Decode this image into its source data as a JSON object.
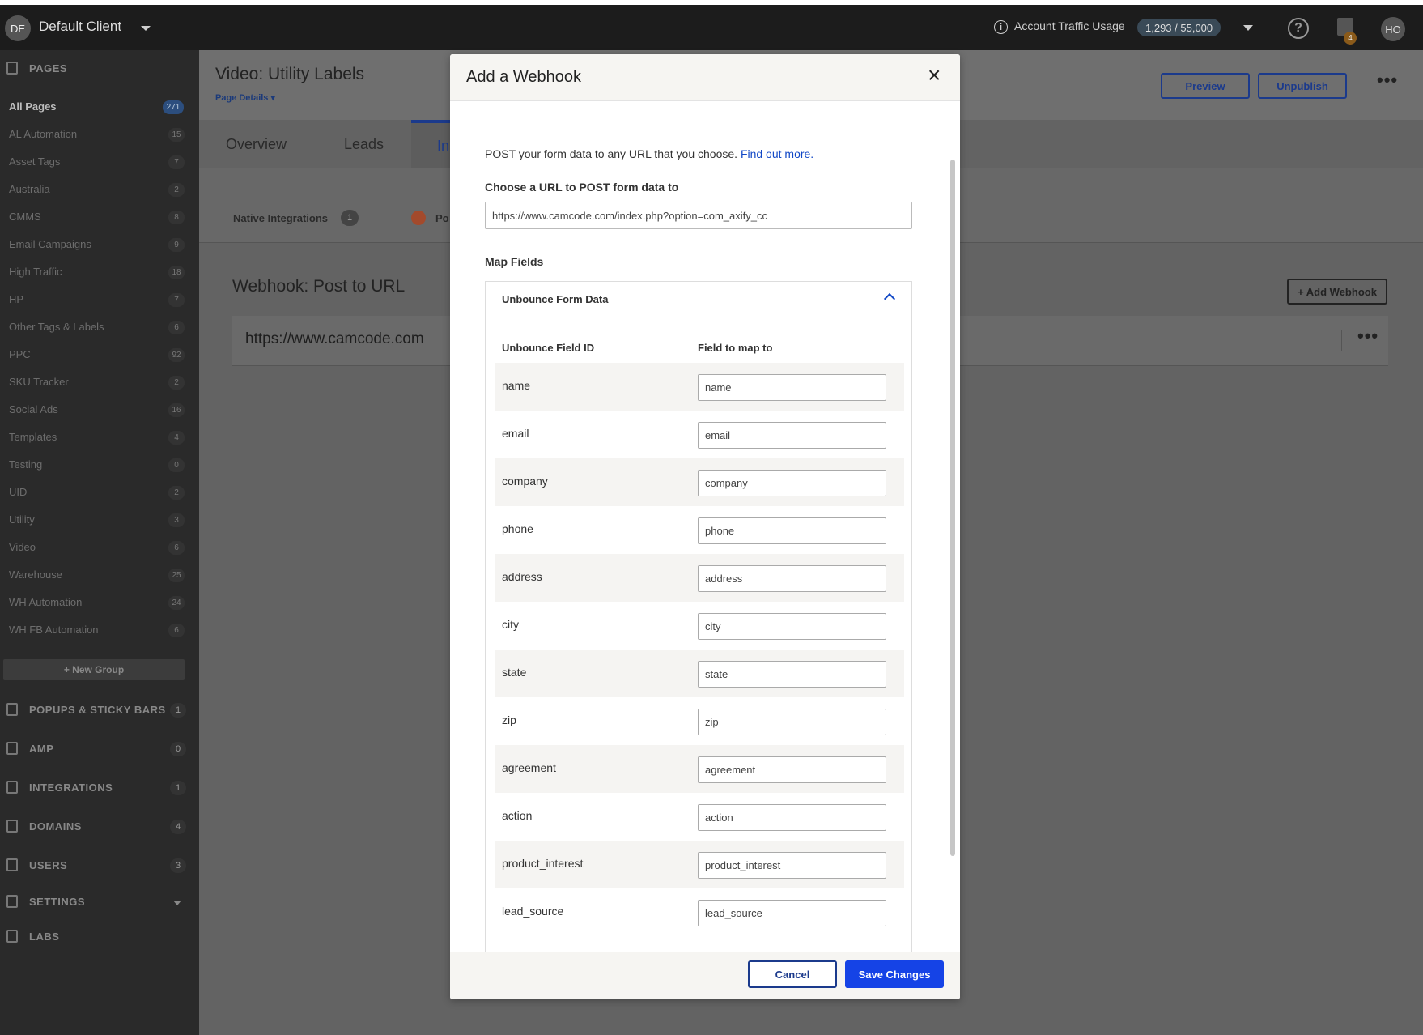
{
  "topbar": {
    "client_initials": "DE",
    "client_name": "Default Client",
    "traffic_label": "Account Traffic Usage",
    "traffic_count": "1,293 / 55,000",
    "gift_badge": "4",
    "user_initials": "HO"
  },
  "sidebar": {
    "pages_section": "PAGES",
    "groups": [
      {
        "label": "All Pages",
        "count": "271"
      },
      {
        "label": "AL Automation",
        "count": "15"
      },
      {
        "label": "Asset Tags",
        "count": "7"
      },
      {
        "label": "Australia",
        "count": "2"
      },
      {
        "label": "CMMS",
        "count": "8"
      },
      {
        "label": "Email Campaigns",
        "count": "9"
      },
      {
        "label": "High Traffic",
        "count": "18"
      },
      {
        "label": "HP",
        "count": "7"
      },
      {
        "label": "Other Tags & Labels",
        "count": "6"
      },
      {
        "label": "PPC",
        "count": "92"
      },
      {
        "label": "SKU Tracker",
        "count": "2"
      },
      {
        "label": "Social Ads",
        "count": "16"
      },
      {
        "label": "Templates",
        "count": "4"
      },
      {
        "label": "Testing",
        "count": "0"
      },
      {
        "label": "UID",
        "count": "2"
      },
      {
        "label": "Utility",
        "count": "3"
      },
      {
        "label": "Video",
        "count": "6"
      },
      {
        "label": "Warehouse",
        "count": "25"
      },
      {
        "label": "WH Automation",
        "count": "24"
      },
      {
        "label": "WH FB Automation",
        "count": "6"
      }
    ],
    "new_group": "+ New Group",
    "sections": [
      {
        "label": "POPUPS & STICKY BARS",
        "count": "1"
      },
      {
        "label": "AMP",
        "count": "0"
      },
      {
        "label": "INTEGRATIONS",
        "count": "1"
      },
      {
        "label": "DOMAINS",
        "count": "4"
      },
      {
        "label": "USERS",
        "count": "3"
      },
      {
        "label": "SETTINGS",
        "count": ""
      },
      {
        "label": "LABS",
        "count": ""
      }
    ]
  },
  "page": {
    "title": "Video: Utility Labels",
    "details": "Page Details",
    "preview": "Preview",
    "unpublish": "Unpublish",
    "tabs": [
      "Overview",
      "Leads",
      "In"
    ],
    "native_integrations": "Native Integrations",
    "native_count": "1",
    "zap_label": "Po",
    "webhook_title": "Webhook: Post to URL",
    "add_webhook": "+ Add Webhook",
    "webhook_url": "https://www.camcode.com"
  },
  "modal": {
    "title": "Add a Webhook",
    "intro": "POST your form data to any URL that you choose.",
    "find_out_more": "Find out more.",
    "url_label": "Choose a URL to POST form data to",
    "url_value": "https://www.camcode.com/index.php?option=com_axify_cc",
    "map_fields": "Map Fields",
    "accordion_title": "Unbounce Form Data",
    "col_field_id": "Unbounce Field ID",
    "col_map_to": "Field to map to",
    "rows": [
      {
        "id": "name",
        "value": "name"
      },
      {
        "id": "email",
        "value": "email"
      },
      {
        "id": "company",
        "value": "company"
      },
      {
        "id": "phone",
        "value": "phone"
      },
      {
        "id": "address",
        "value": "address"
      },
      {
        "id": "city",
        "value": "city"
      },
      {
        "id": "state",
        "value": "state"
      },
      {
        "id": "zip",
        "value": "zip"
      },
      {
        "id": "agreement",
        "value": "agreement"
      },
      {
        "id": "action",
        "value": "action"
      },
      {
        "id": "product_interest",
        "value": "product_interest"
      },
      {
        "id": "lead_source",
        "value": "lead_source"
      }
    ],
    "cancel": "Cancel",
    "save": "Save Changes"
  }
}
